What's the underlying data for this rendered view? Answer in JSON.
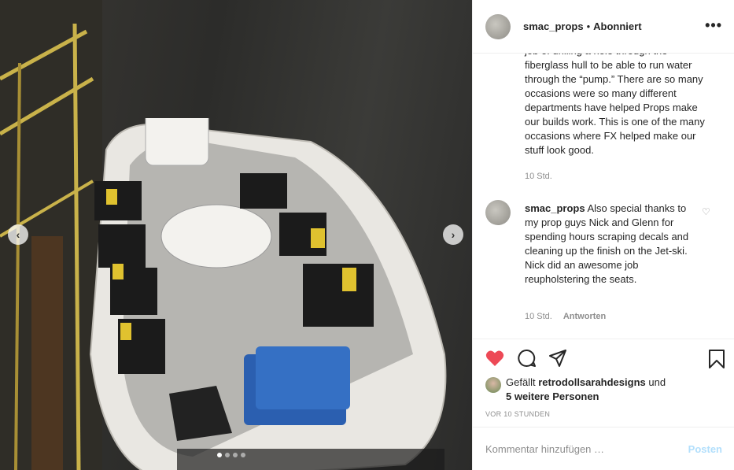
{
  "post": {
    "username": "smac_props",
    "separator": "•",
    "follow_status": "Abonniert",
    "more_label": "•••"
  },
  "comments": {
    "first": {
      "text": "job of drilling a hole through the fiberglass hull to be able to run water through the “pump.” There are so many occasions were so many different departments have helped Props make our builds work. This is one of the many occasions where FX helped make our stuff look good.",
      "time": "10 Std."
    },
    "second": {
      "username": "smac_props",
      "text": "Also special thanks to my prop guys Nick and Glenn for spending hours scraping decals and cleaning up the finish on the Jet-ski. Nick did an awesome job reupholstering the seats.",
      "time": "10 Std.",
      "reply": "Antworten"
    }
  },
  "likes": {
    "prefix": "Gefällt",
    "user": "retrodollsarahdesigns",
    "and": "und",
    "others": "5 weitere Personen"
  },
  "timestamp": "VOR 10 STUNDEN",
  "comment_box": {
    "placeholder": "Kommentar hinzufügen …",
    "post_label": "Posten"
  },
  "carousel": {
    "prev": "‹",
    "next": "›",
    "slides": 4,
    "active_slide": 1
  },
  "colors": {
    "like_red": "#ed4956",
    "post_disabled": "#b2dffc",
    "muted": "#8e8e8e"
  }
}
